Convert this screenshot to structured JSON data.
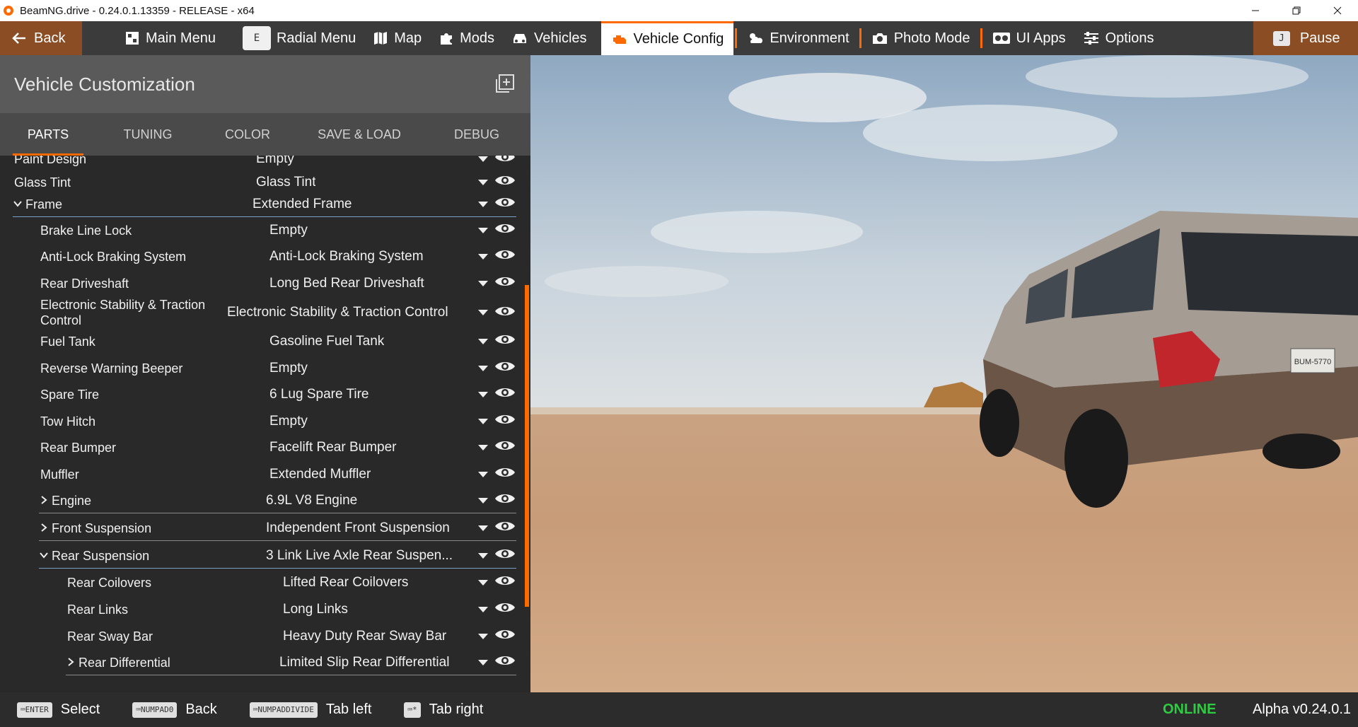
{
  "window": {
    "title": "BeamNG.drive - 0.24.0.1.13359 - RELEASE - x64"
  },
  "topnav": {
    "back": "Back",
    "items": [
      {
        "label": "Main Menu"
      },
      {
        "label": "Radial Menu",
        "key": "E"
      },
      {
        "label": "Map"
      },
      {
        "label": "Mods"
      },
      {
        "label": "Vehicles"
      },
      {
        "label": "Vehicle Config"
      },
      {
        "label": "Environment"
      },
      {
        "label": "Photo Mode"
      },
      {
        "label": "UI Apps"
      },
      {
        "label": "Options"
      }
    ],
    "pause": "Pause",
    "pause_key": "J",
    "accent_color": "#ff6a00"
  },
  "panel": {
    "title": "Vehicle Customization",
    "tabs": [
      "PARTS",
      "TUNING",
      "COLOR",
      "SAVE & LOAD",
      "DEBUG"
    ],
    "active_tab": "PARTS",
    "rows": [
      {
        "label": "Paint Design",
        "value": "Empty"
      },
      {
        "label": "Glass Tint",
        "value": "Glass Tint"
      },
      {
        "label": "Frame",
        "value": "Extended Frame"
      },
      {
        "label": "Brake Line Lock",
        "value": "Empty"
      },
      {
        "label": "Anti-Lock Braking System",
        "value": "Anti-Lock Braking System"
      },
      {
        "label": "Rear Driveshaft",
        "value": "Long Bed Rear Driveshaft"
      },
      {
        "label": "Electronic Stability & Traction Control",
        "value": "Electronic Stability & Traction Control"
      },
      {
        "label": "Fuel Tank",
        "value": "Gasoline Fuel Tank"
      },
      {
        "label": "Reverse Warning Beeper",
        "value": "Empty"
      },
      {
        "label": "Spare Tire",
        "value": "6 Lug Spare Tire"
      },
      {
        "label": "Tow Hitch",
        "value": "Empty"
      },
      {
        "label": "Rear Bumper",
        "value": "Facelift Rear Bumper"
      },
      {
        "label": "Muffler",
        "value": "Extended Muffler"
      },
      {
        "label": "Engine",
        "value": "6.9L V8 Engine"
      },
      {
        "label": "Front Suspension",
        "value": "Independent Front Suspension"
      },
      {
        "label": "Rear Suspension",
        "value": "3 Link Live Axle Rear Suspen..."
      },
      {
        "label": "Rear Coilovers",
        "value": "Lifted Rear Coilovers"
      },
      {
        "label": "Rear Links",
        "value": "Long Links"
      },
      {
        "label": "Rear Sway Bar",
        "value": "Heavy Duty Rear Sway Bar"
      },
      {
        "label": "Rear Differential",
        "value": "Limited Slip Rear Differential"
      }
    ]
  },
  "viewport": {
    "license_plate": "BUM-5770"
  },
  "bottombar": {
    "hints": [
      {
        "key": "ENTER",
        "label": "Select"
      },
      {
        "key": "NUMPAD0",
        "label": "Back"
      },
      {
        "key": "NUMPADDIVIDE",
        "label": "Tab left"
      },
      {
        "key": "*",
        "label": "Tab right"
      }
    ],
    "status": "ONLINE",
    "status_color": "#2ecc40",
    "version": "Alpha v0.24.0.1"
  }
}
